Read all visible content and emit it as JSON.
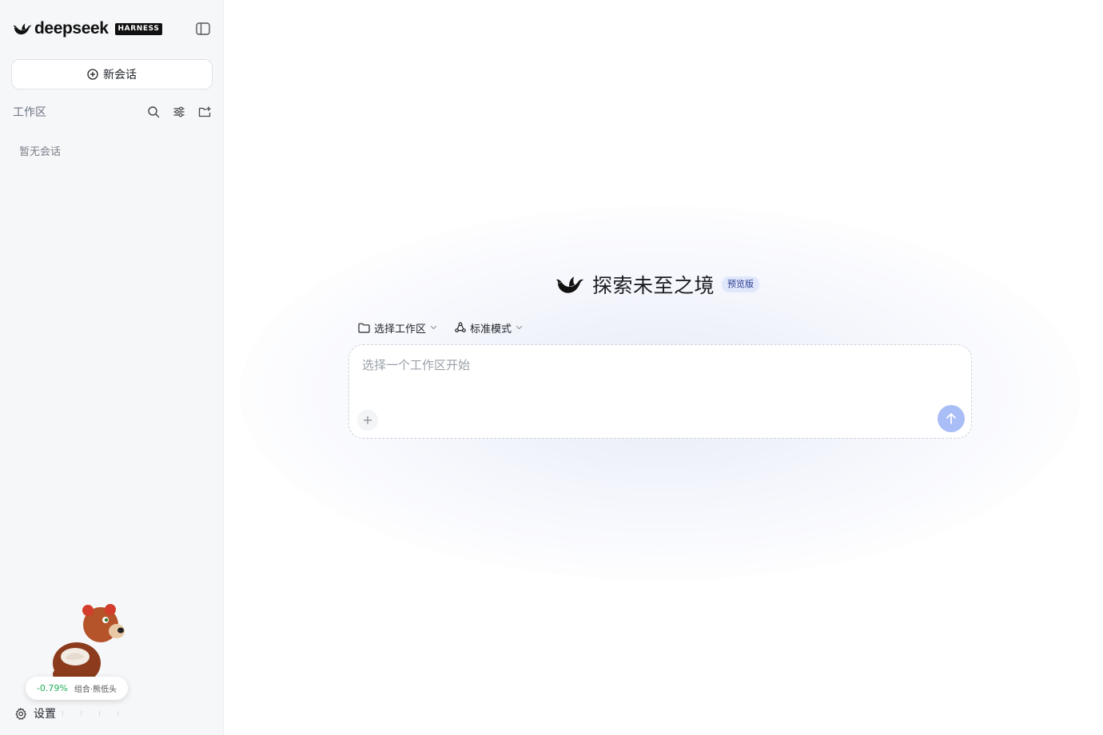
{
  "sidebar": {
    "brand": {
      "wordmark": "deepseek",
      "tag": "HARNESS"
    },
    "new_chat_label": "新会话",
    "workspace_label": "工作区",
    "empty_text": "暂无会话",
    "settings_label": "设置",
    "stock": {
      "change": "-0.79%",
      "name": "组合·熊低头"
    }
  },
  "main": {
    "title": "探索未至之境",
    "badge": "预览版",
    "workspace_select": "选择工作区",
    "mode_select": "标准模式",
    "input": {
      "placeholder": "选择一个工作区开始",
      "value": ""
    }
  },
  "colors": {
    "accent": "#a9bdf6",
    "badge_bg": "#e1e7fb",
    "positive": "#1fae5a"
  },
  "icons": [
    "whale-logo",
    "sidebar-toggle-icon",
    "plus-circle-icon",
    "search-icon",
    "filter-icon",
    "new-folder-icon",
    "folder-icon",
    "mode-icon",
    "chevron-down-icon",
    "plus-icon",
    "arrow-up-icon",
    "gear-icon"
  ]
}
